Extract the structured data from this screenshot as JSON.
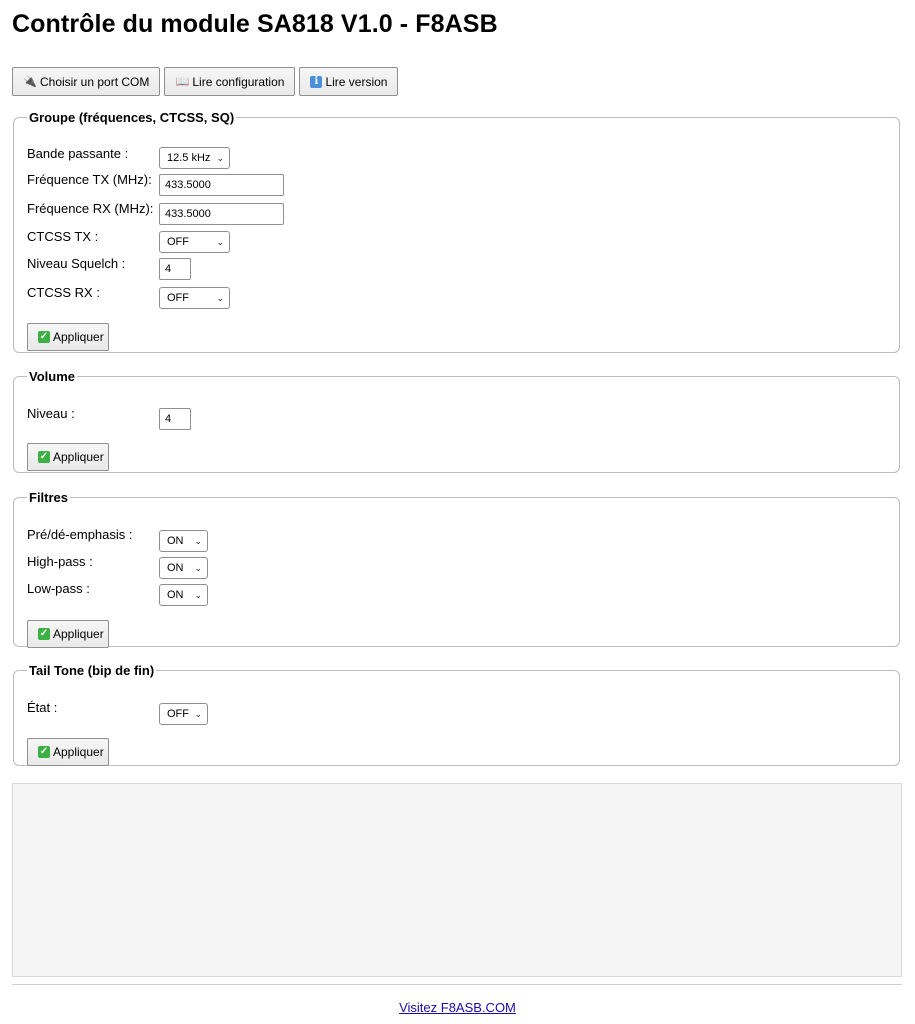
{
  "page": {
    "title": "Contrôle du module SA818 V1.0 - F8ASB"
  },
  "toolbar": {
    "com_label": "Choisir un port COM",
    "read_config_label": "Lire configuration",
    "read_version_label": "Lire version"
  },
  "group": {
    "legend": "Groupe (fréquences, CTCSS, SQ)",
    "bandwidth_label": "Bande passante :",
    "bandwidth_value": "12.5 kHz",
    "tx_label": "Fréquence TX (MHz):",
    "tx_value": "433.5000",
    "rx_label": "Fréquence RX (MHz):",
    "rx_value": "433.5000",
    "ctcss_tx_label": "CTCSS TX :",
    "ctcss_tx_value": "OFF",
    "squelch_label": "Niveau Squelch :",
    "squelch_value": "4",
    "ctcss_rx_label": "CTCSS RX :",
    "ctcss_rx_value": "OFF",
    "apply_label": "Appliquer"
  },
  "volume": {
    "legend": "Volume",
    "level_label": "Niveau :",
    "level_value": "4",
    "apply_label": "Appliquer"
  },
  "filters": {
    "legend": "Filtres",
    "emphasis_label": "Pré/dé-emphasis :",
    "emphasis_value": "ON",
    "highpass_label": "High-pass :",
    "highpass_value": "ON",
    "lowpass_label": "Low-pass :",
    "lowpass_value": "ON",
    "apply_label": "Appliquer"
  },
  "tailtone": {
    "legend": "Tail Tone (bip de fin)",
    "state_label": "État :",
    "state_value": "OFF",
    "apply_label": "Appliquer"
  },
  "log": {
    "content": ""
  },
  "footer": {
    "link_text": "Visitez F8ASB.COM"
  },
  "colors": {
    "link": "#1a0dab",
    "log_bg": "#f5f5f5",
    "check_green": "#3cb043"
  },
  "icons": {
    "com": "plug-icon",
    "read_config": "book-icon",
    "read_version": "info-icon",
    "apply": "checkmark-icon"
  }
}
